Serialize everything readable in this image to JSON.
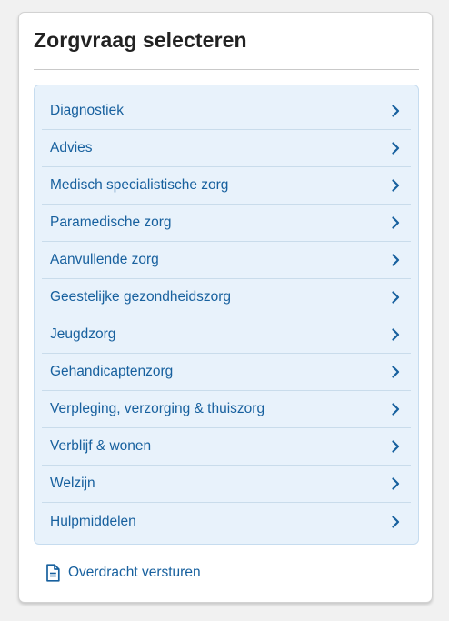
{
  "panel": {
    "title": "Zorgvraag selecteren"
  },
  "care_categories": [
    {
      "label": "Diagnostiek",
      "icon": "chevron-right-icon"
    },
    {
      "label": "Advies",
      "icon": "chevron-right-icon"
    },
    {
      "label": "Medisch specialistische zorg",
      "icon": "chevron-right-icon"
    },
    {
      "label": "Paramedische zorg",
      "icon": "chevron-right-icon"
    },
    {
      "label": "Aanvullende zorg",
      "icon": "chevron-right-icon"
    },
    {
      "label": "Geestelijke gezondheidszorg",
      "icon": "chevron-right-icon"
    },
    {
      "label": "Jeugdzorg",
      "icon": "chevron-right-icon"
    },
    {
      "label": "Gehandicaptenzorg",
      "icon": "chevron-right-icon"
    },
    {
      "label": "Verpleging, verzorging & thuiszorg",
      "icon": "chevron-right-icon"
    },
    {
      "label": "Verblijf & wonen",
      "icon": "chevron-right-icon"
    },
    {
      "label": "Welzijn",
      "icon": "chevron-right-icon"
    },
    {
      "label": "Hulpmiddelen",
      "icon": "chevron-right-icon"
    }
  ],
  "footer": {
    "link_label": "Overdracht versturen",
    "icon": "document-icon"
  },
  "colors": {
    "link": "#17609e",
    "list_background": "#e8f2fb",
    "list_border": "#c6dcef",
    "title": "#222222"
  }
}
